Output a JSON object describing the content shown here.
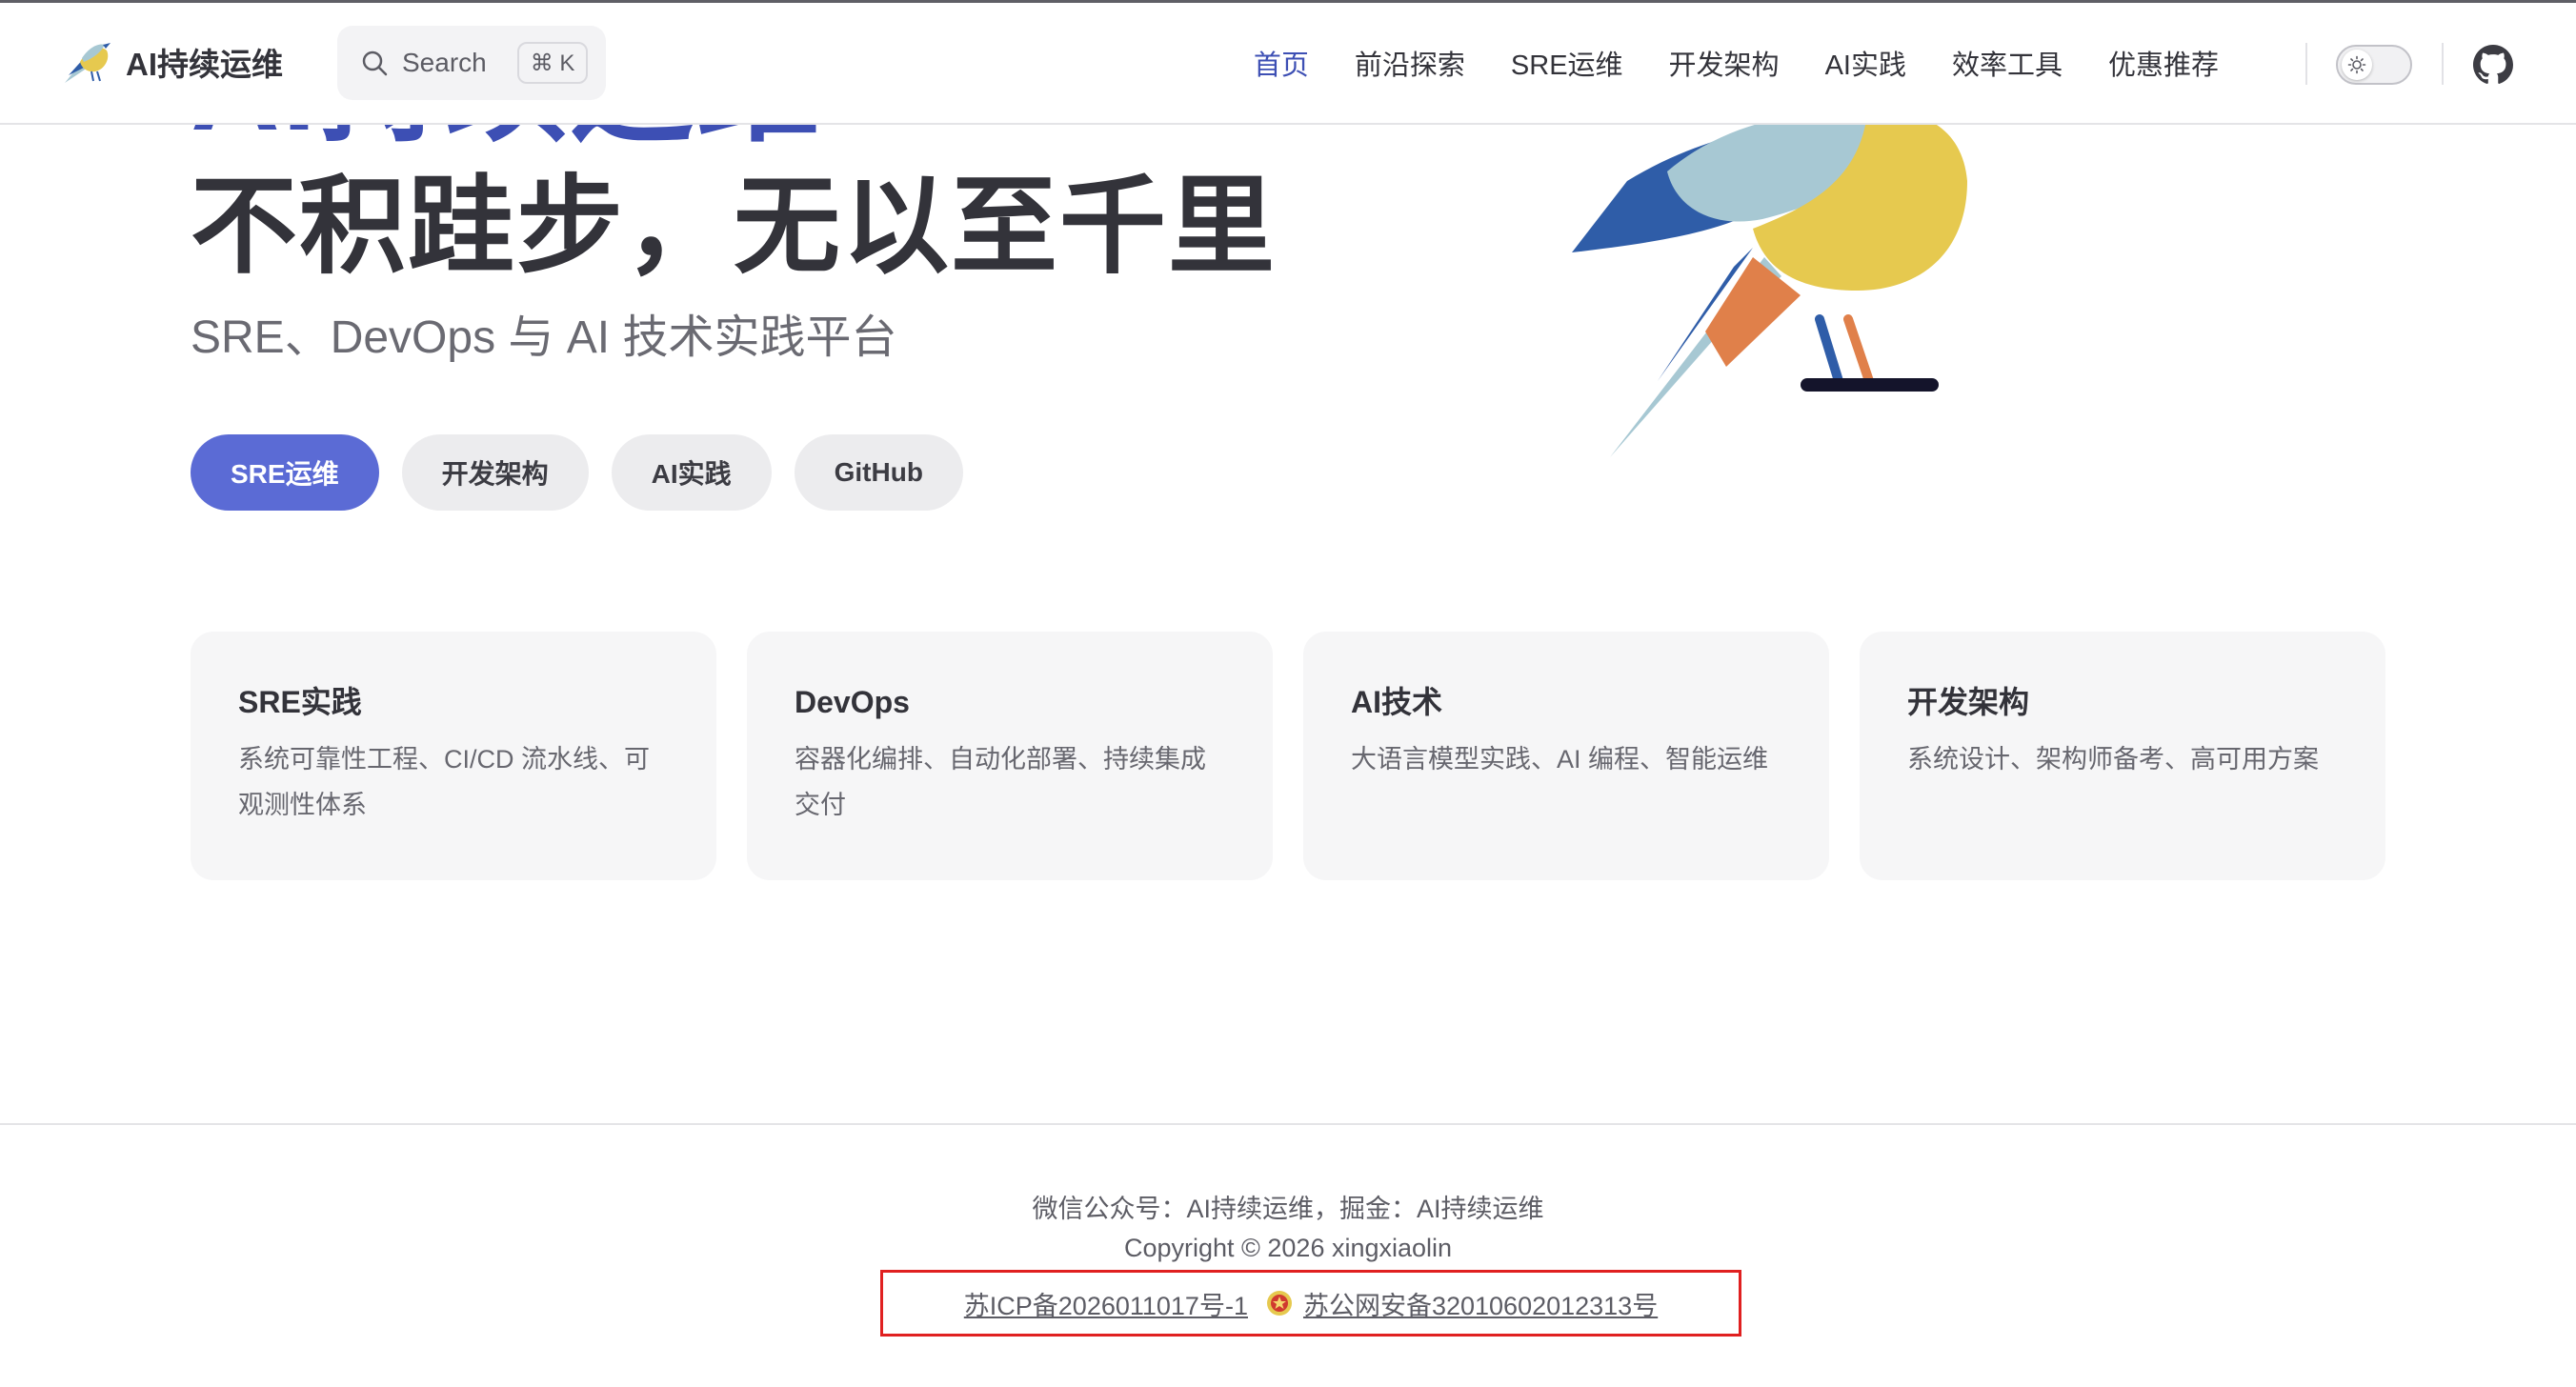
{
  "site": {
    "title": "AI持续运维"
  },
  "search": {
    "label": "Search",
    "shortcut": "⌘ K"
  },
  "nav": {
    "items": [
      {
        "label": "首页",
        "active": true
      },
      {
        "label": "前沿探索"
      },
      {
        "label": "SRE运维"
      },
      {
        "label": "开发架构"
      },
      {
        "label": "AI实践"
      },
      {
        "label": "效率工具"
      },
      {
        "label": "优惠推荐"
      }
    ]
  },
  "hero": {
    "name": "AI持续运维",
    "text": "不积跬步，无以至千里",
    "tagline": "SRE、DevOps 与 AI 技术实践平台",
    "actions": [
      {
        "label": "SRE运维",
        "theme": "brand"
      },
      {
        "label": "开发架构",
        "theme": "alt"
      },
      {
        "label": "AI实践",
        "theme": "alt"
      },
      {
        "label": "GitHub",
        "theme": "alt"
      }
    ]
  },
  "features": [
    {
      "title": "SRE实践",
      "details": "系统可靠性工程、CI/CD 流水线、可观测性体系"
    },
    {
      "title": "DevOps",
      "details": "容器化编排、自动化部署、持续集成交付"
    },
    {
      "title": "AI技术",
      "details": "大语言模型实践、AI 编程、智能运维"
    },
    {
      "title": "开发架构",
      "details": "系统设计、架构师备考、高可用方案"
    }
  ],
  "footer": {
    "message": "微信公众号：AI持续运维，掘金：AI持续运维",
    "copyright": "Copyright © 2026 xingxiaolin",
    "icp": "苏ICP备2026011017号-1",
    "police": "苏公网安备32010602012313号"
  },
  "colors": {
    "brand": "#3d4fb4",
    "brand_button": "#5b6bd5",
    "highlight_box": "#e02020",
    "bird_blue": "#2f5da8",
    "bird_light": "#a7c8d3",
    "bird_yellow": "#e6c94f",
    "bird_orange": "#e0804a"
  },
  "icons": {
    "logo": "bird-logo-icon",
    "search": "search-icon",
    "theme": "sun-icon",
    "social": "github-icon",
    "police": "police-badge-icon"
  }
}
